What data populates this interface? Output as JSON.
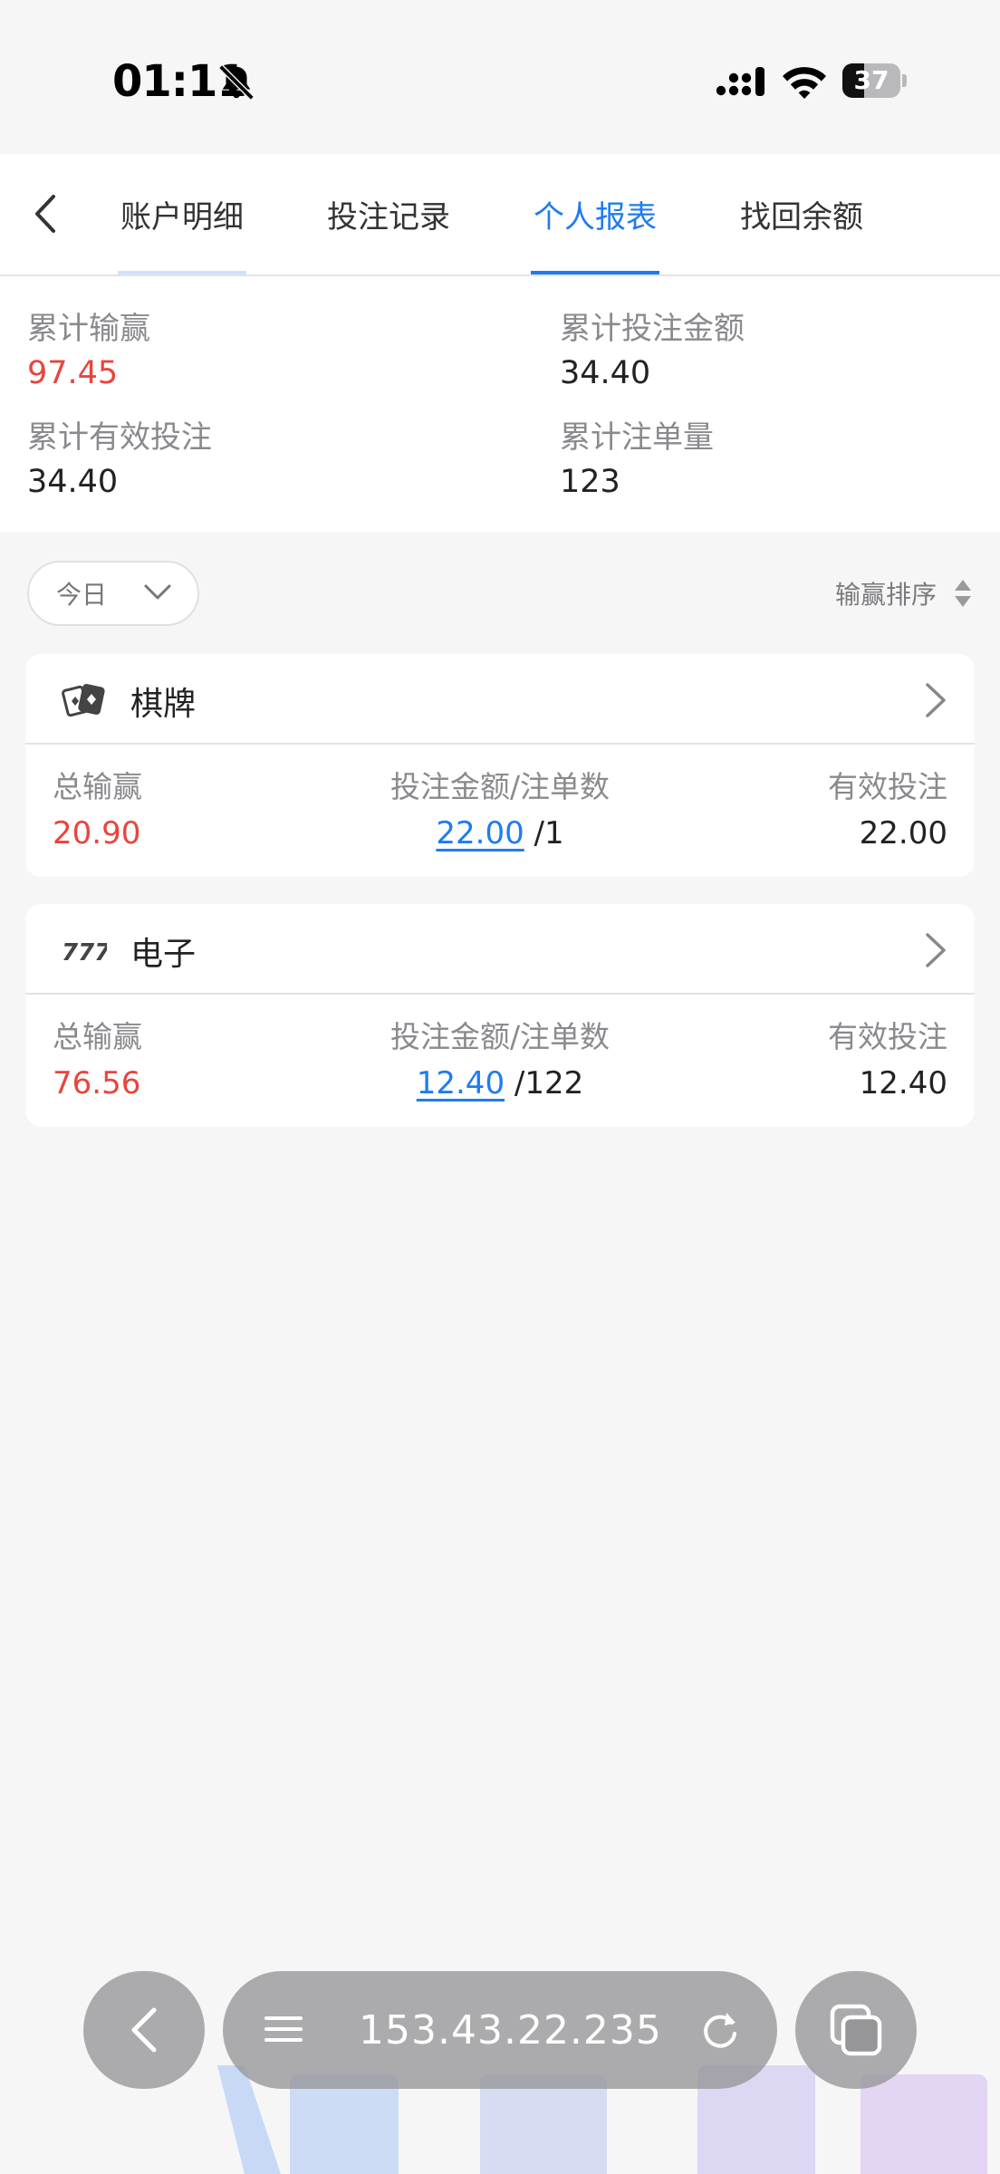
{
  "status_bar": {
    "time": "01:11",
    "battery_percent": 37,
    "battery_label": "37"
  },
  "tabs": [
    {
      "label": "账户明细",
      "active": false
    },
    {
      "label": "投注记录",
      "active": false
    },
    {
      "label": "个人报表",
      "active": true
    },
    {
      "label": "找回余额",
      "active": false
    }
  ],
  "summary": {
    "total_win_loss_label": "累计输赢",
    "total_win_loss_value": "97.45",
    "total_bet_amount_label": "累计投注金额",
    "total_bet_amount_value": "34.40",
    "total_valid_bet_label": "累计有效投注",
    "total_valid_bet_value": "34.40",
    "total_orders_label": "累计注单量",
    "total_orders_value": "123"
  },
  "filter": {
    "date_selected": "今日",
    "sort_label": "输赢排序"
  },
  "cards": [
    {
      "title": "棋牌",
      "icon": "playing-cards-icon",
      "win_loss_label": "总输赢",
      "win_loss_value": "20.90",
      "bet_label": "投注金额/注单数",
      "bet_amount": "22.00",
      "bet_count": "/1",
      "valid_label": "有效投注",
      "valid_value": "22.00"
    },
    {
      "title": "电子",
      "icon": "slot-777-icon",
      "win_loss_label": "总输赢",
      "win_loss_value": "76.56",
      "bet_label": "投注金额/注单数",
      "bet_amount": "12.40",
      "bet_count": "/122",
      "valid_label": "有效投注",
      "valid_value": "12.40"
    }
  ],
  "browser": {
    "url": "153.43.22.235"
  },
  "colors": {
    "accent": "#1e7cf0",
    "negative": "#e8453c"
  }
}
